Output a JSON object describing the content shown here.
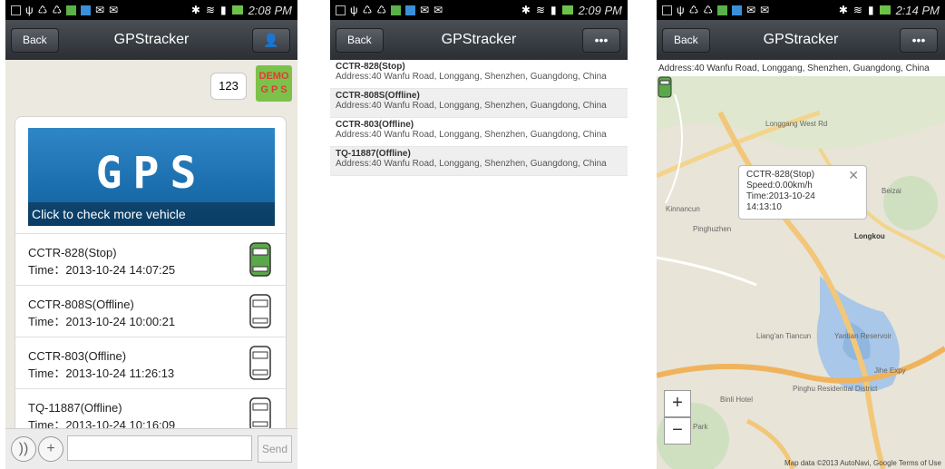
{
  "status_bar": {
    "times": [
      "2:08 PM",
      "2:09 PM",
      "2:14 PM"
    ]
  },
  "screen1": {
    "back_label": "Back",
    "title": "GPStracker",
    "message_text": "123",
    "avatar_line1": "DEMO",
    "avatar_line2": "G P S",
    "banner_big": "GPS",
    "banner_caption": "Click to check more vehicle",
    "vehicles": [
      {
        "name": "CCTR-828(Stop)",
        "time": "Time：2013-10-24 14:07:25",
        "status_color": "#5aa84a"
      },
      {
        "name": "CCTR-808S(Offline)",
        "time": "Time：2013-10-24 10:00:21",
        "status_color": "#ffffff"
      },
      {
        "name": "CCTR-803(Offline)",
        "time": "Time：2013-10-24 11:26:13",
        "status_color": "#ffffff"
      },
      {
        "name": "TQ-11887(Offline)",
        "time": "Time：2013-10-24 10:16:09",
        "status_color": "#ffffff"
      }
    ],
    "send_label": "Send"
  },
  "screen2": {
    "back_label": "Back",
    "title": "GPStracker",
    "menu_label": "•••",
    "items": [
      {
        "title": "CCTR-828(Stop)",
        "address": "Address:40 Wanfu Road, Longgang, Shenzhen, Guangdong, China"
      },
      {
        "title": "CCTR-808S(Offline)",
        "address": "Address:40 Wanfu Road, Longgang, Shenzhen, Guangdong, China"
      },
      {
        "title": "CCTR-803(Offline)",
        "address": "Address:40 Wanfu Road, Longgang, Shenzhen, Guangdong, China"
      },
      {
        "title": "TQ-11887(Offline)",
        "address": "Address:40 Wanfu Road, Longgang, Shenzhen, Guangdong, China"
      }
    ]
  },
  "screen3": {
    "back_label": "Back",
    "title": "GPStracker",
    "menu_label": "•••",
    "address": "Address:40 Wanfu Road, Longgang, Shenzhen, Guangdong, China",
    "popup": {
      "name": "CCTR-828(Stop)",
      "speed": "Speed:0.00km/h",
      "time_line1": "Time:2013-10-24",
      "time_line2": "14:13:10"
    },
    "zoom_in": "+",
    "zoom_out": "−",
    "credit": "Map data ©2013 AutoNavi, Google   Terms of Use",
    "labels": {
      "longgang_west": "Longgang West Rd",
      "kinnancun": "Kinnancun",
      "pinghuzhen": "Pinghuzhen",
      "longkou": "Longkou",
      "beizai": "Beizai",
      "liangan": "Liang'an Tiancun",
      "yantian": "Yantian Reservoir",
      "binli": "Binli Hotel",
      "pinghu_res": "Pinghu Residential District",
      "park": "Park",
      "jihe": "Jihe Expy"
    }
  }
}
